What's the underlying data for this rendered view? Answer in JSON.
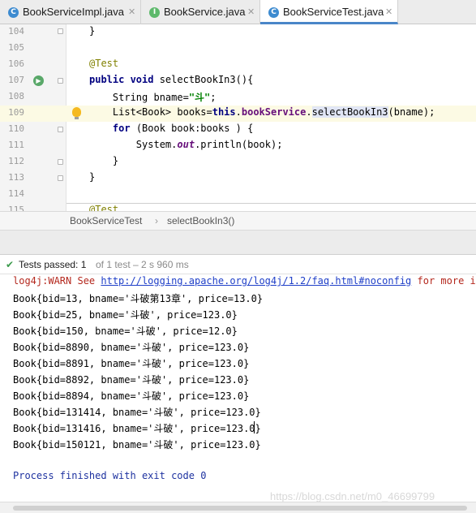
{
  "tabs": [
    {
      "label": "BookServiceImpl.java",
      "icon": "class-icon",
      "icon_letter": "C",
      "active": false
    },
    {
      "label": "BookService.java",
      "icon": "interface-icon",
      "icon_letter": "I",
      "active": false
    },
    {
      "label": "BookServiceTest.java",
      "icon": "class-icon",
      "icon_letter": "C",
      "active": true
    }
  ],
  "editor": {
    "line_numbers": [
      "104",
      "105",
      "106",
      "107",
      "108",
      "109",
      "110",
      "111",
      "112",
      "113",
      "114",
      "115"
    ],
    "code": {
      "l104": "}",
      "l106_annotation": "@Test",
      "l107_kw": "public void",
      "l107_rest": " selectBookIn3(){",
      "l108_type": "String bname=",
      "l108_str": "\"斗\"",
      "l108_end": ";",
      "l109_a": "List<Book> books=",
      "l109_this": "this",
      "l109_dot": ".",
      "l109_field": "bookService",
      "l109_dot2": ".",
      "l109_method": "selectBookIn3",
      "l109_end": "(bname);",
      "l110_kw": "for",
      "l110_rest": " (Book book:books ) {",
      "l111_a": "System.",
      "l111_out": "out",
      "l111_end": ".println(book);",
      "l112": "}",
      "l113": "}",
      "l115_annotation": "@Test"
    }
  },
  "breadcrumb": {
    "class_name": "BookServiceTest",
    "separator": "›",
    "method_name": "selectBookIn3()"
  },
  "test_status": {
    "label": "Tests passed: 1",
    "detail": "of 1 test – 2 s 960 ms"
  },
  "console": {
    "warn_prefix": "log4j:WARN See ",
    "warn_link": "http://logging.apache.org/log4j/1.2/faq.html#noconfig",
    "warn_suffix": " for more info.",
    "output_lines": [
      "Book{bid=13, bname='斗破第13章', price=13.0}",
      "Book{bid=25, bname='斗破', price=123.0}",
      "Book{bid=150, bname='斗破', price=12.0}",
      "Book{bid=8890, bname='斗破', price=123.0}",
      "Book{bid=8891, bname='斗破', price=123.0}",
      "Book{bid=8892, bname='斗破', price=123.0}",
      "Book{bid=8894, bname='斗破', price=123.0}",
      "Book{bid=131414, bname='斗破', price=123.0}",
      "Book{bid=131416, bname='斗破', price=123.0}",
      "Book{bid=150121, bname='斗破', price=123.0}"
    ],
    "process_line": "Process finished with exit code 0"
  },
  "watermark": "https://blog.csdn.net/m0_46699799"
}
